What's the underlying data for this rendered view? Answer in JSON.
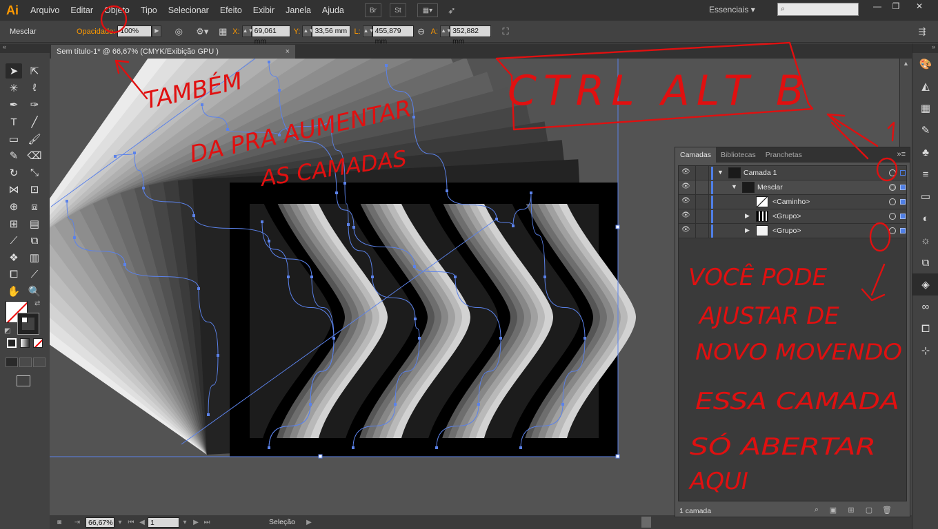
{
  "app": {
    "logo": "Ai",
    "menu": [
      "Arquivo",
      "Editar",
      "Objeto",
      "Tipo",
      "Selecionar",
      "Efeito",
      "Exibir",
      "Janela",
      "Ajuda"
    ],
    "bridge_label": "Br",
    "stock_label": "St",
    "workspace": "Essenciais",
    "search_placeholder": ""
  },
  "control_bar": {
    "object_type": "Mesclar",
    "opacity_label": "Opacidade:",
    "opacity_value": "100%",
    "x_label": "X:",
    "x_value": "69,061 mm",
    "y_label": "Y:",
    "y_value": "33,56 mm",
    "w_label": "L:",
    "w_value": "455,879 mm",
    "h_label": "A:",
    "h_value": "352,882 mm"
  },
  "document": {
    "tab_title": "Sem título-1* @ 66,67% (CMYK/Exibição GPU )",
    "close": "×"
  },
  "status_bar": {
    "zoom": "66,67%",
    "artboard": "1",
    "tool": "Seleção"
  },
  "layers_panel": {
    "tabs": [
      "Camadas",
      "Bibliotecas",
      "Pranchetas"
    ],
    "rows": [
      {
        "name": "Camada 1",
        "depth": 0,
        "expanded": true
      },
      {
        "name": "Mesclar",
        "depth": 1,
        "expanded": true
      },
      {
        "name": "<Caminho>",
        "depth": 2,
        "expanded": false
      },
      {
        "name": "<Grupo>",
        "depth": 2,
        "expanded": false
      },
      {
        "name": "<Grupo>",
        "depth": 2,
        "expanded": false
      }
    ],
    "count": "1 camada"
  },
  "annotations": {
    "shortcut": "CTRL ALT B",
    "note1": [
      "TAMBÉM",
      "DA PRA AUMENTAR",
      "AS CAMADAS"
    ],
    "note2": [
      "VOCÊ PODE",
      "AJUSTAR DE",
      "NOVO MOVENDO",
      "ESSA CAMADA",
      "SÓ ABERTAR",
      "AQUI"
    ],
    "number": "1"
  },
  "colors": {
    "accent": "#ff9a00",
    "selection": "#4f7fe6",
    "annotation": "#e01010"
  }
}
